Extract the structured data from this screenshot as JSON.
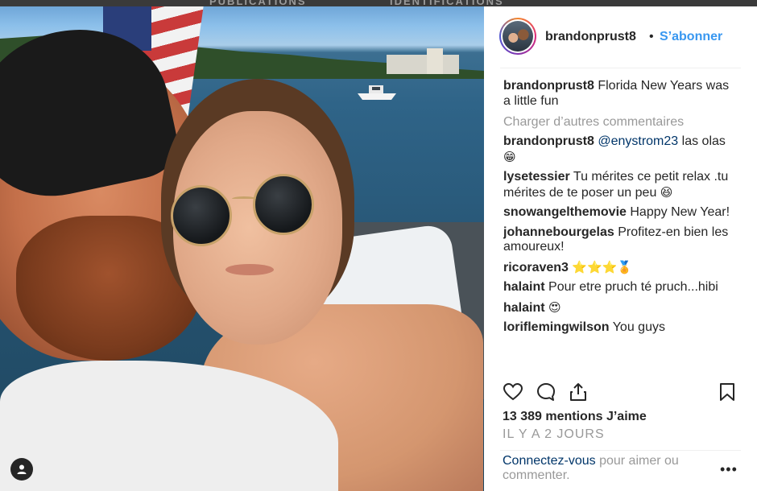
{
  "background_tabs": [
    "PUBLICATIONS",
    "IDENTIFICATIONS"
  ],
  "post": {
    "author": "brandonprust8",
    "follow_label": "S’abonner",
    "separator": "•",
    "caption": {
      "user": "brandonprust8",
      "text": "Florida New Years was a little fun"
    },
    "load_more_label": "Charger d’autres commentaires",
    "comments": [
      {
        "user": "brandonprust8",
        "mention": "@enystrom23",
        "text": "las olas",
        "emoji": "😁"
      },
      {
        "user": "lysetessier",
        "mention": "",
        "text": "Tu mérites ce petit relax .tu mérites de te poser un peu",
        "emoji": "😆"
      },
      {
        "user": "snowangelthemovie",
        "mention": "",
        "text": "Happy New Year!",
        "emoji": ""
      },
      {
        "user": "johannebourgelas",
        "mention": "",
        "text": "Profitez-en bien les amoureux!",
        "emoji": ""
      },
      {
        "user": "ricoraven3",
        "mention": "",
        "text": "",
        "emoji": "⭐⭐⭐🏅"
      },
      {
        "user": "halaint",
        "mention": "",
        "text": "Pour etre pruch té pruch...hibi",
        "emoji": ""
      },
      {
        "user": "halaint",
        "mention": "",
        "text": "",
        "emoji": "😍"
      },
      {
        "user": "loriflemingwilson",
        "mention": "",
        "text": "You guys",
        "emoji": ""
      }
    ],
    "likes": "13 389 mentions J’aime",
    "time_ago": "IL Y A 2 JOURS",
    "login_prompt": {
      "link": "Connectez-vous",
      "text": "pour aimer ou commenter."
    },
    "more_label": "•••"
  },
  "icons": {
    "like": "heart-icon",
    "comment": "comment-icon",
    "share": "share-icon",
    "save": "bookmark-icon",
    "profile": "user-icon"
  },
  "colors": {
    "link_blue": "#3897f0",
    "dark_link": "#003569",
    "text": "#262626",
    "muted": "#999999"
  }
}
